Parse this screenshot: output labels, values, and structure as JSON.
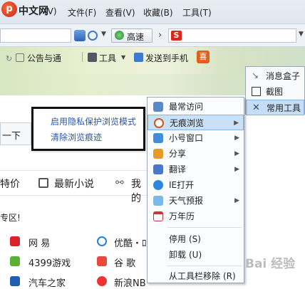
{
  "menubar": {
    "logo_mark": "p",
    "logo_text": "中文网",
    "items": [
      "(V)",
      "文件(F)",
      "查看(V)",
      "收藏(B)",
      "工具(T)"
    ]
  },
  "toolbar": {
    "speed_label": "高速"
  },
  "banner": {
    "bulletin_label": "公告与通",
    "tools_label": "工具",
    "send_label": "发送到手机"
  },
  "right_menu": {
    "items": [
      {
        "label": "消息盒子",
        "icon": "message-box-icon"
      },
      {
        "label": "截图",
        "icon": "screenshot-icon"
      },
      {
        "label": "常用工具",
        "icon": "tools-icon"
      }
    ]
  },
  "context_menu": {
    "items": [
      {
        "label": "最常访问",
        "icon": "frequent-icon",
        "submenu": false
      },
      {
        "label": "无痕浏览",
        "icon": "incognito-icon",
        "submenu": true,
        "highlighted": true
      },
      {
        "label": "小号窗口",
        "icon": "alt-window-icon",
        "submenu": true
      },
      {
        "label": "分享",
        "icon": "share-icon",
        "submenu": true
      },
      {
        "label": "翻译",
        "icon": "translate-icon",
        "submenu": true
      },
      {
        "label": "IE打开",
        "icon": "ie-icon",
        "submenu": false
      },
      {
        "label": "天气预报",
        "icon": "weather-icon",
        "submenu": true
      },
      {
        "label": "万年历",
        "icon": "calendar-icon",
        "submenu": false
      }
    ],
    "disable": {
      "label": "停用",
      "accel": "(S)"
    },
    "uninstall": {
      "label": "卸载",
      "accel": "(U)"
    },
    "remove": {
      "label": "从工具栏移除",
      "accel": "(R)"
    }
  },
  "incognito_submenu": {
    "items": [
      "启用隐私保护浏览模式",
      "清除浏览痕迹"
    ]
  },
  "page": {
    "search_btn": "一下",
    "tabs": [
      "特价",
      "最新小说",
      "我的"
    ],
    "zone": "专区!",
    "sites": [
      [
        "网 易",
        "优酷・ﾛ"
      ],
      [
        "4399游戏",
        "谷 歌"
      ],
      [
        "汽车之家",
        "新浪NB"
      ]
    ]
  },
  "watermark": "Bai 经验"
}
